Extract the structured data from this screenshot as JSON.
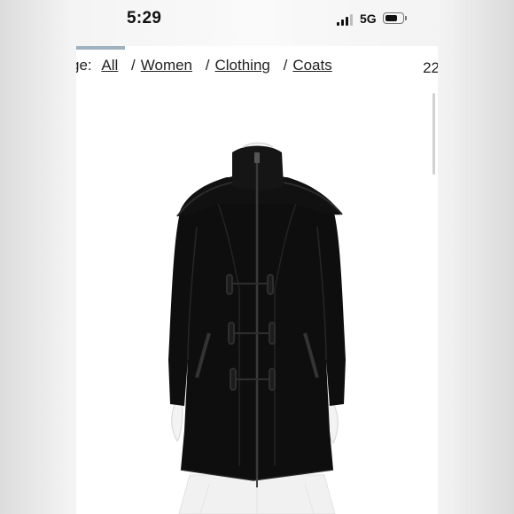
{
  "status_bar": {
    "time": "5:29",
    "network": "5G",
    "signal_bars_filled": 3,
    "signal_bars_total": 4,
    "battery_icon": "battery-icon"
  },
  "breadcrumb": {
    "prefix": "ge:",
    "items": [
      {
        "label": "All"
      },
      {
        "label": "Women"
      },
      {
        "label": "Clothing"
      },
      {
        "label": "Coats"
      }
    ],
    "separator": "/"
  },
  "cut_off_text": "22",
  "product_image": {
    "subject": "black-wool-toggle-coat-on-mannequin",
    "colors": {
      "coat": "#0e0e0e",
      "skirt": "#f2f2f2",
      "background": "#ffffff"
    }
  }
}
